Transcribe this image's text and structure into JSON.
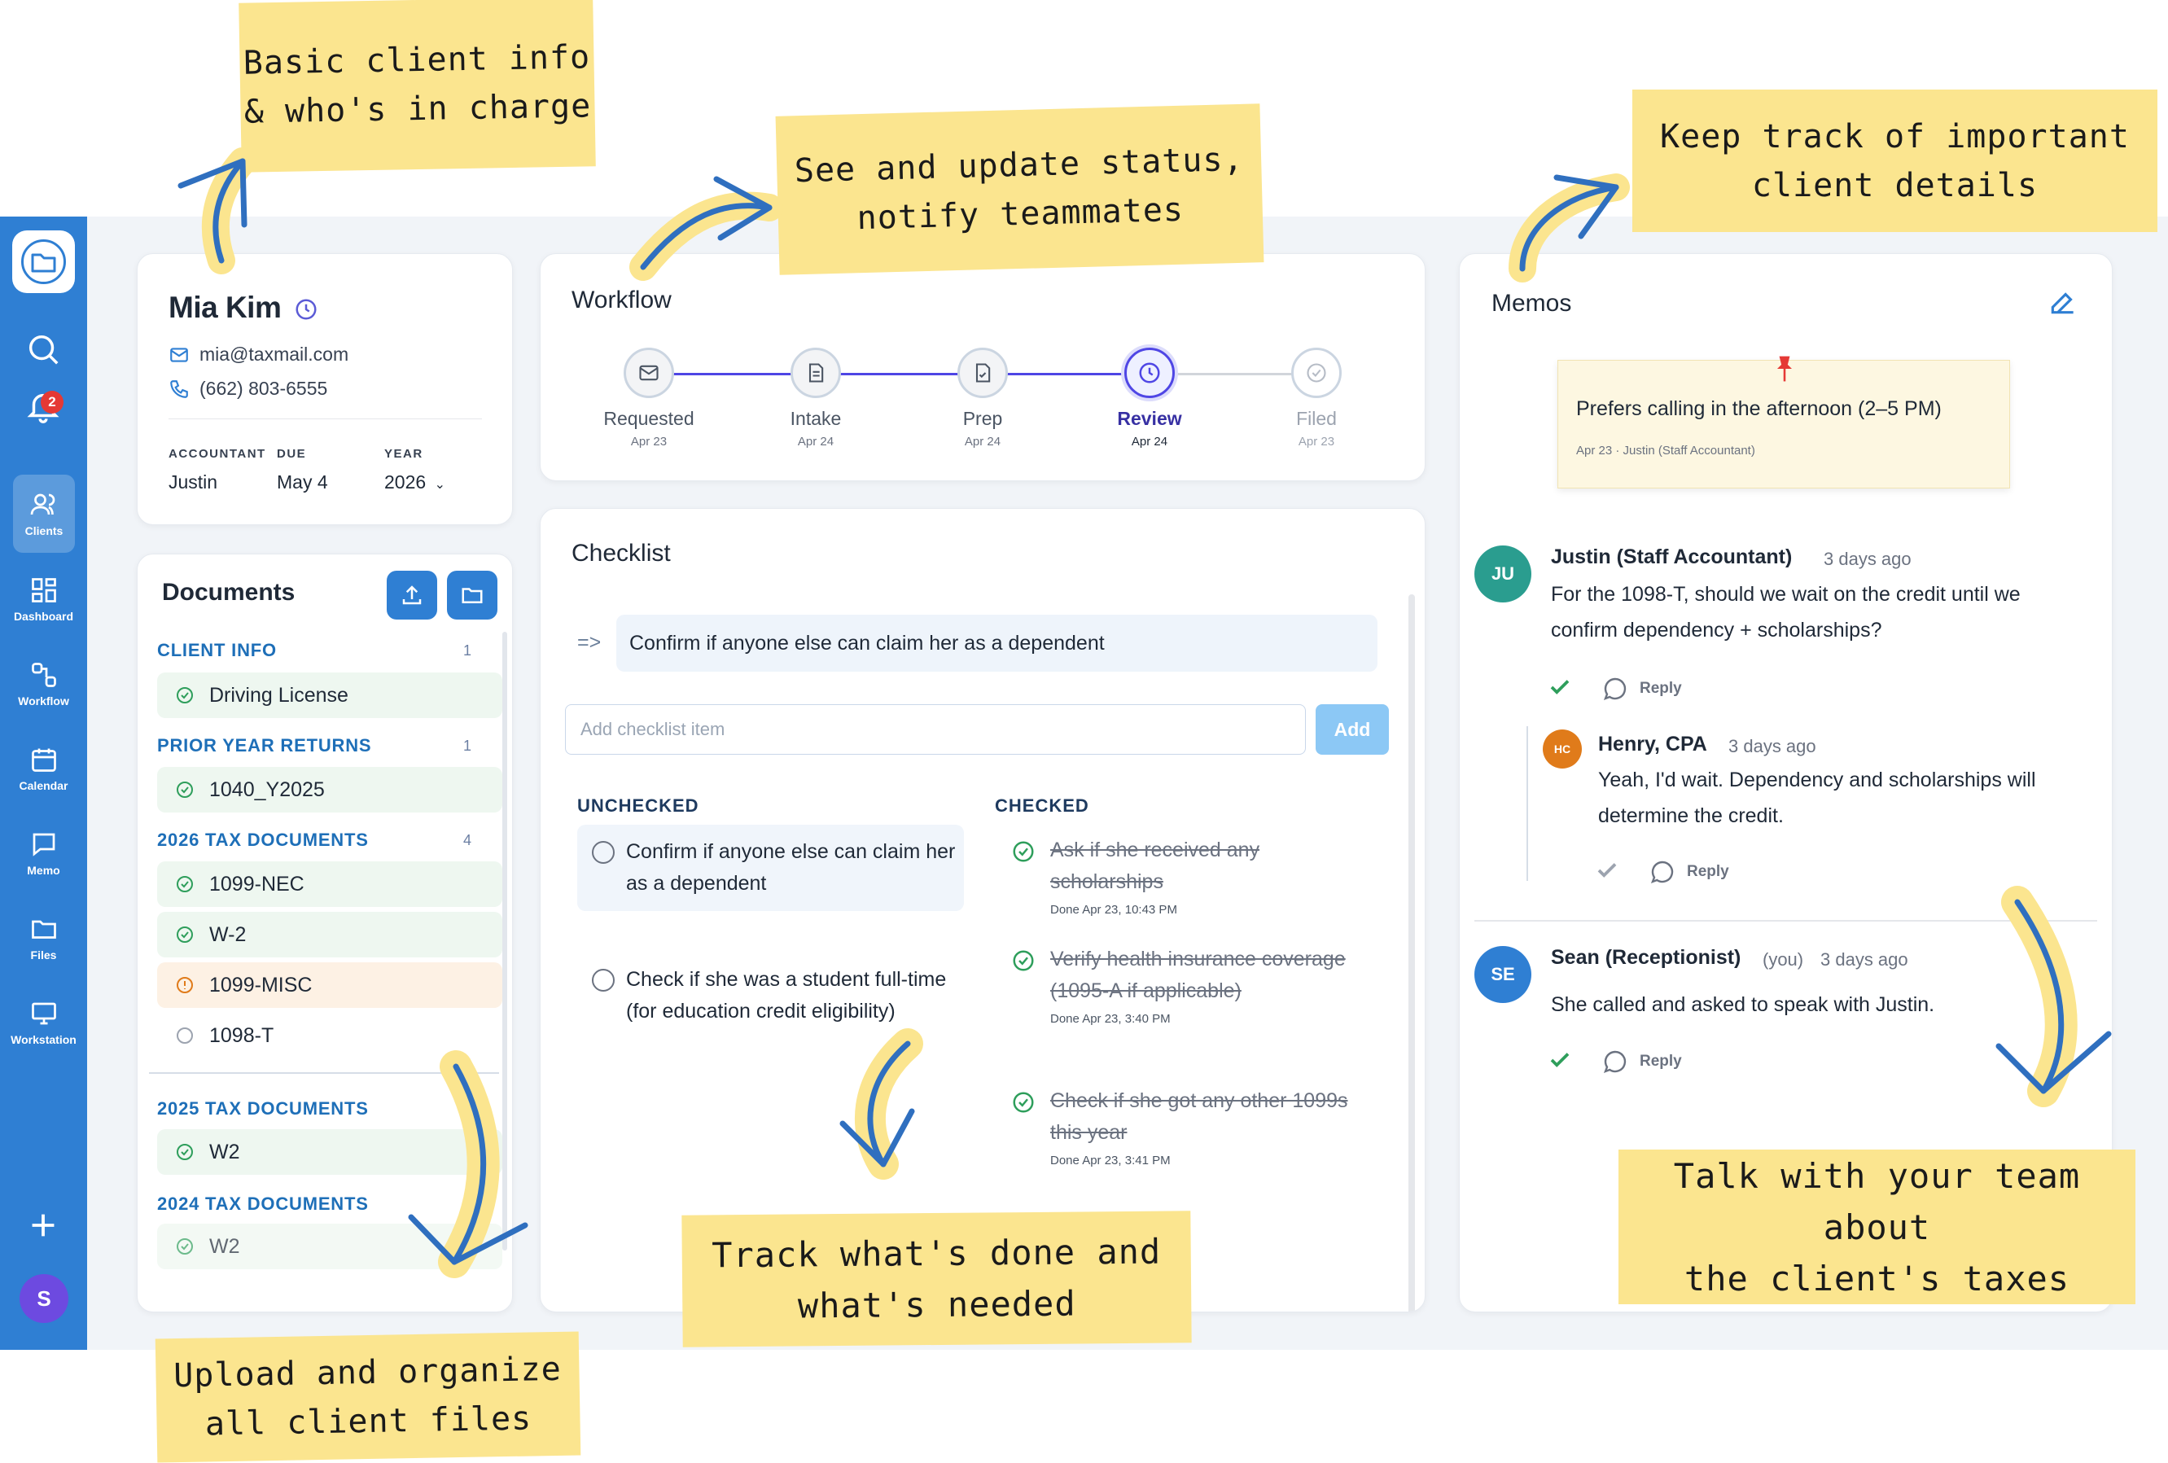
{
  "annotations": {
    "client_info": "Basic client info\n& who's in charge",
    "status": "See and update status,\nnotify teammates",
    "memos": "Keep track of important\nclient details",
    "files": "Upload and organize\nall client files",
    "checklist": "Track what's done and\nwhat's needed",
    "team": "Talk with your team about\nthe client's taxes"
  },
  "sidebar": {
    "notification_count": "2",
    "items": [
      {
        "label": "Clients",
        "icon": "clients-icon"
      },
      {
        "label": "Dashboard",
        "icon": "dashboard-icon"
      },
      {
        "label": "Workflow",
        "icon": "workflow-icon"
      },
      {
        "label": "Calendar",
        "icon": "calendar-icon"
      },
      {
        "label": "Memo",
        "icon": "memo-icon"
      },
      {
        "label": "Files",
        "icon": "files-icon"
      },
      {
        "label": "Workstation",
        "icon": "workstation-icon"
      }
    ],
    "user_initial": "S"
  },
  "client": {
    "name": "Mia Kim",
    "email": "mia@taxmail.com",
    "phone": "(662) 803-6555",
    "accountant_label": "ACCOUNTANT",
    "accountant": "Justin",
    "due_label": "DUE",
    "due": "May 4",
    "year_label": "YEAR",
    "year": "2026"
  },
  "documents": {
    "title": "Documents",
    "categories": [
      {
        "label": "CLIENT INFO",
        "count": "1",
        "items": [
          {
            "name": "Driving License",
            "status": "done"
          }
        ]
      },
      {
        "label": "PRIOR YEAR RETURNS",
        "count": "1",
        "items": [
          {
            "name": "1040_Y2025",
            "status": "done"
          }
        ]
      },
      {
        "label": "2026 TAX DOCUMENTS",
        "count": "4",
        "items": [
          {
            "name": "1099-NEC",
            "status": "done"
          },
          {
            "name": "W-2",
            "status": "done"
          },
          {
            "name": "1099-MISC",
            "status": "warning"
          },
          {
            "name": "1098-T",
            "status": "pending"
          }
        ]
      },
      {
        "label": "2025 TAX DOCUMENTS",
        "count": "",
        "items": [
          {
            "name": "W2",
            "status": "done"
          }
        ]
      },
      {
        "label": "2024 TAX DOCUMENTS",
        "count": "",
        "items": [
          {
            "name": "W2",
            "status": "done"
          }
        ]
      }
    ]
  },
  "workflow": {
    "title": "Workflow",
    "steps": [
      {
        "name": "Requested",
        "date": "Apr 23",
        "icon": "mail-icon"
      },
      {
        "name": "Intake",
        "date": "Apr 24",
        "icon": "document-icon"
      },
      {
        "name": "Prep",
        "date": "Apr 24",
        "icon": "file-check-icon"
      },
      {
        "name": "Review",
        "date": "Apr 24",
        "icon": "clock-icon"
      },
      {
        "name": "Filed",
        "date": "Apr 23",
        "icon": "check-circle-icon"
      }
    ],
    "active_step": "Review"
  },
  "checklist": {
    "title": "Checklist",
    "arrow": "=>",
    "focus_item": "Confirm if anyone else can claim her as a dependent",
    "input_placeholder": "Add checklist item",
    "add_label": "Add",
    "unchecked_label": "UNCHECKED",
    "checked_label": "CHECKED",
    "unchecked": [
      "Confirm if anyone else can claim her as a dependent",
      "Check if she was a student full-time (for education credit eligibility)"
    ],
    "checked": [
      {
        "text": "Ask if she received any scholarships",
        "done": "Done Apr 23, 10:43 PM"
      },
      {
        "text": "Verify health insurance coverage (1095-A if applicable)",
        "done": "Done Apr 23, 3:40 PM"
      },
      {
        "text": "Check if she got any other 1099s this year",
        "done": "Done Apr 23, 3:41 PM"
      }
    ]
  },
  "memos": {
    "title": "Memos",
    "pinned": {
      "text": "Prefers calling in the afternoon (2–5 PM)",
      "meta": "Apr 23 · Justin (Staff Accountant)"
    },
    "comments": [
      {
        "initials": "JU",
        "name": "Justin (Staff Accountant)",
        "time": "3 days ago",
        "body": "For the 1098-T, should we wait on the credit until we confirm dependency + scholarships?",
        "reply": "Reply",
        "color": "#2a9d8f"
      },
      {
        "initials": "HC",
        "name": "Henry, CPA",
        "time": "3 days ago",
        "body": "Yeah, I'd wait. Dependency and scholarships will determine the credit.",
        "reply": "Reply",
        "color": "#e07b1a"
      },
      {
        "initials": "SE",
        "name": "Sean (Receptionist)",
        "you": "(you)",
        "time": "3 days ago",
        "body": "She called and asked to speak with Justin.",
        "reply": "Reply",
        "color": "#2f7fd3"
      }
    ]
  }
}
